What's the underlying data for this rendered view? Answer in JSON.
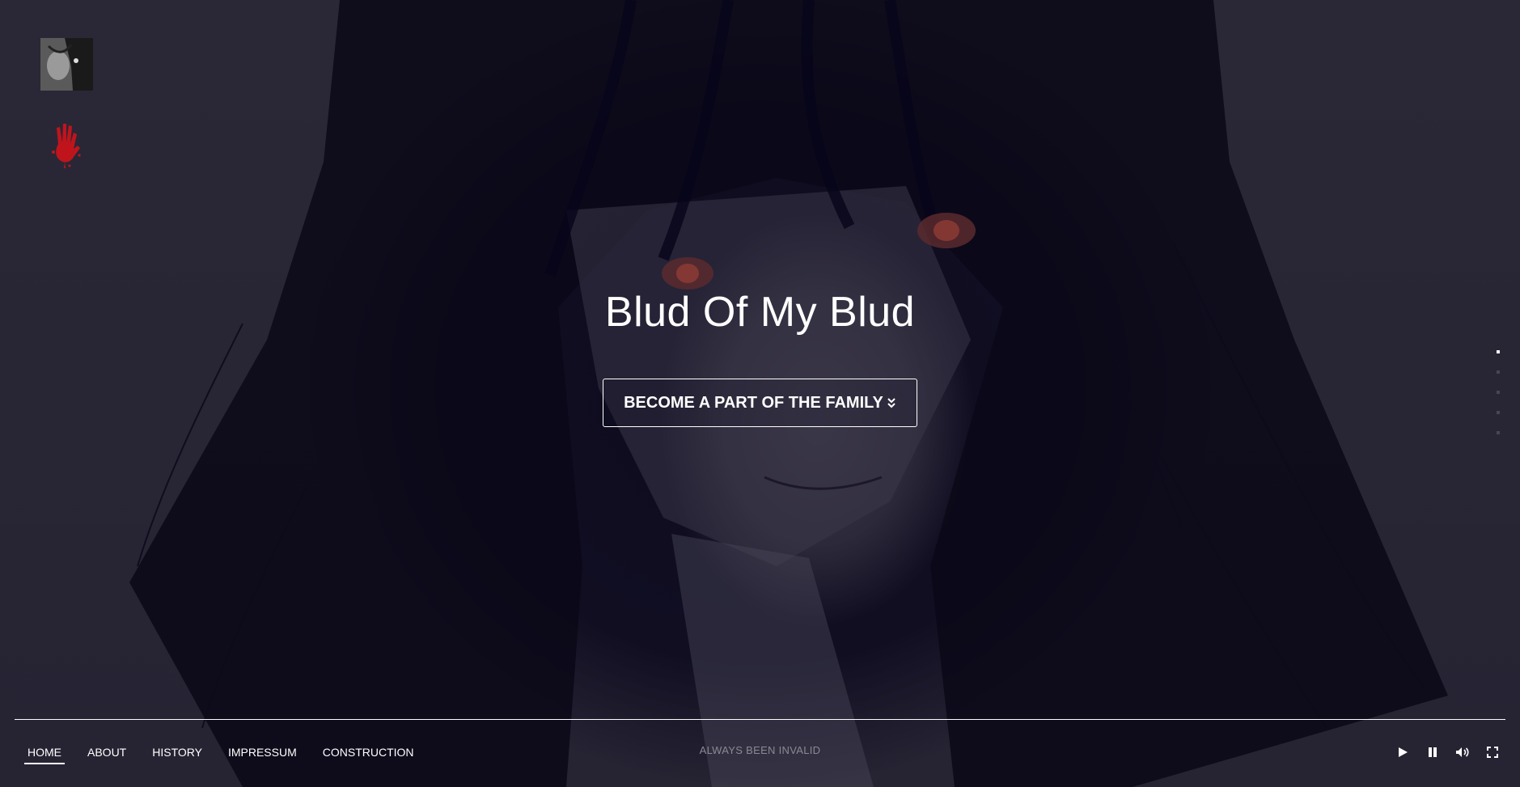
{
  "hero": {
    "title": "Blud Of My Blud",
    "cta_label": "BECOME A PART OF THE FAMILY"
  },
  "sidebar": {
    "logo_icon": "avatar-thumbnail",
    "hand_icon": "bloody-hand-icon",
    "hand_color": "#c0141c"
  },
  "section_dots": {
    "count": 5,
    "active_index": 0
  },
  "nav": {
    "items": [
      {
        "label": "HOME",
        "active": true
      },
      {
        "label": "ABOUT",
        "active": false
      },
      {
        "label": "HISTORY",
        "active": false
      },
      {
        "label": "IMPRESSUM",
        "active": false
      },
      {
        "label": "CONSTRUCTION",
        "active": false
      }
    ]
  },
  "footer": {
    "tagline": "ALWAYS BEEN INVALID"
  },
  "controls": [
    "play-icon",
    "pause-icon",
    "volume-icon",
    "fullscreen-icon"
  ],
  "colors": {
    "background": "#2a2836",
    "text": "#ffffff",
    "tagline": "#8b8896"
  }
}
